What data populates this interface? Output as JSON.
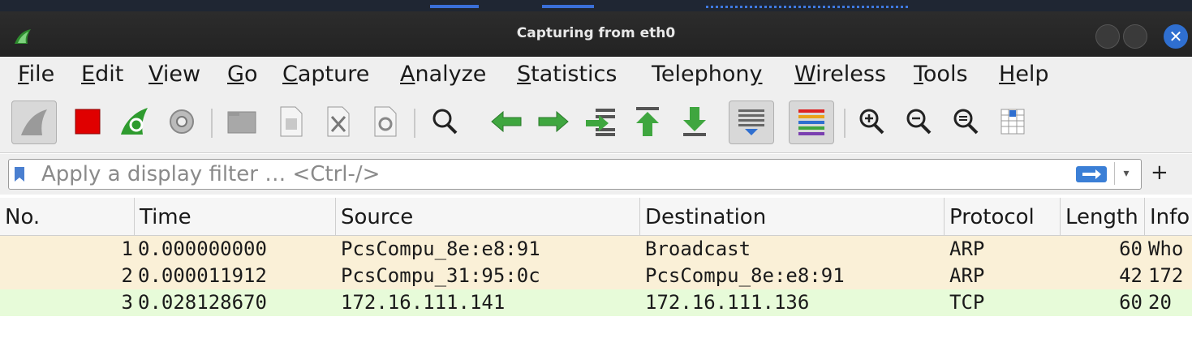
{
  "window": {
    "title": "Capturing from eth0"
  },
  "menu": [
    {
      "label": "File",
      "key": "F",
      "rest": "ile"
    },
    {
      "label": "Edit",
      "key": "E",
      "rest": "dit"
    },
    {
      "label": "View",
      "key": "V",
      "rest": "iew"
    },
    {
      "label": "Go",
      "key": "G",
      "rest": "o"
    },
    {
      "label": "Capture",
      "key": "C",
      "rest": "apture"
    },
    {
      "label": "Analyze",
      "key": "A",
      "rest": "nalyze"
    },
    {
      "label": "Statistics",
      "key": "S",
      "rest": "tatistics"
    },
    {
      "label": "Telephony",
      "pre": "Telephon",
      "key": "y",
      "rest": ""
    },
    {
      "label": "Wireless",
      "key": "W",
      "rest": "ireless"
    },
    {
      "label": "Tools",
      "key": "T",
      "rest": "ools"
    },
    {
      "label": "Help",
      "key": "H",
      "rest": "elp"
    }
  ],
  "toolbar_icons": [
    "start-capture-icon",
    "stop-capture-icon",
    "restart-capture-icon",
    "capture-options-icon",
    "open-file-icon",
    "save-file-icon",
    "close-file-icon",
    "reload-file-icon",
    "find-packet-icon",
    "go-back-icon",
    "go-forward-icon",
    "go-to-packet-icon",
    "first-packet-icon",
    "last-packet-icon",
    "auto-scroll-icon",
    "colorize-icon",
    "zoom-in-icon",
    "zoom-out-icon",
    "normal-size-icon",
    "resize-columns-icon"
  ],
  "filter": {
    "placeholder": "Apply a display filter … <Ctrl-/>",
    "value": ""
  },
  "columns": [
    "No.",
    "Time",
    "Source",
    "Destination",
    "Protocol",
    "Length",
    "Info"
  ],
  "packets": [
    {
      "no": "1",
      "time": "0.000000000",
      "source": "PcsCompu_8e:e8:91",
      "destination": "Broadcast",
      "protocol": "ARP",
      "length": "60",
      "info": "Who",
      "color": "#faf0d7"
    },
    {
      "no": "2",
      "time": "0.000011912",
      "source": "PcsCompu_31:95:0c",
      "destination": "PcsCompu_8e:e8:91",
      "protocol": "ARP",
      "length": "42",
      "info": "172",
      "color": "#faf0d7"
    },
    {
      "no": "3",
      "time": "0.028128670",
      "source": "172.16.111.141",
      "destination": "172.16.111.136",
      "protocol": "TCP",
      "length": "60",
      "info": "20",
      "color": "#e7fbd9"
    }
  ]
}
